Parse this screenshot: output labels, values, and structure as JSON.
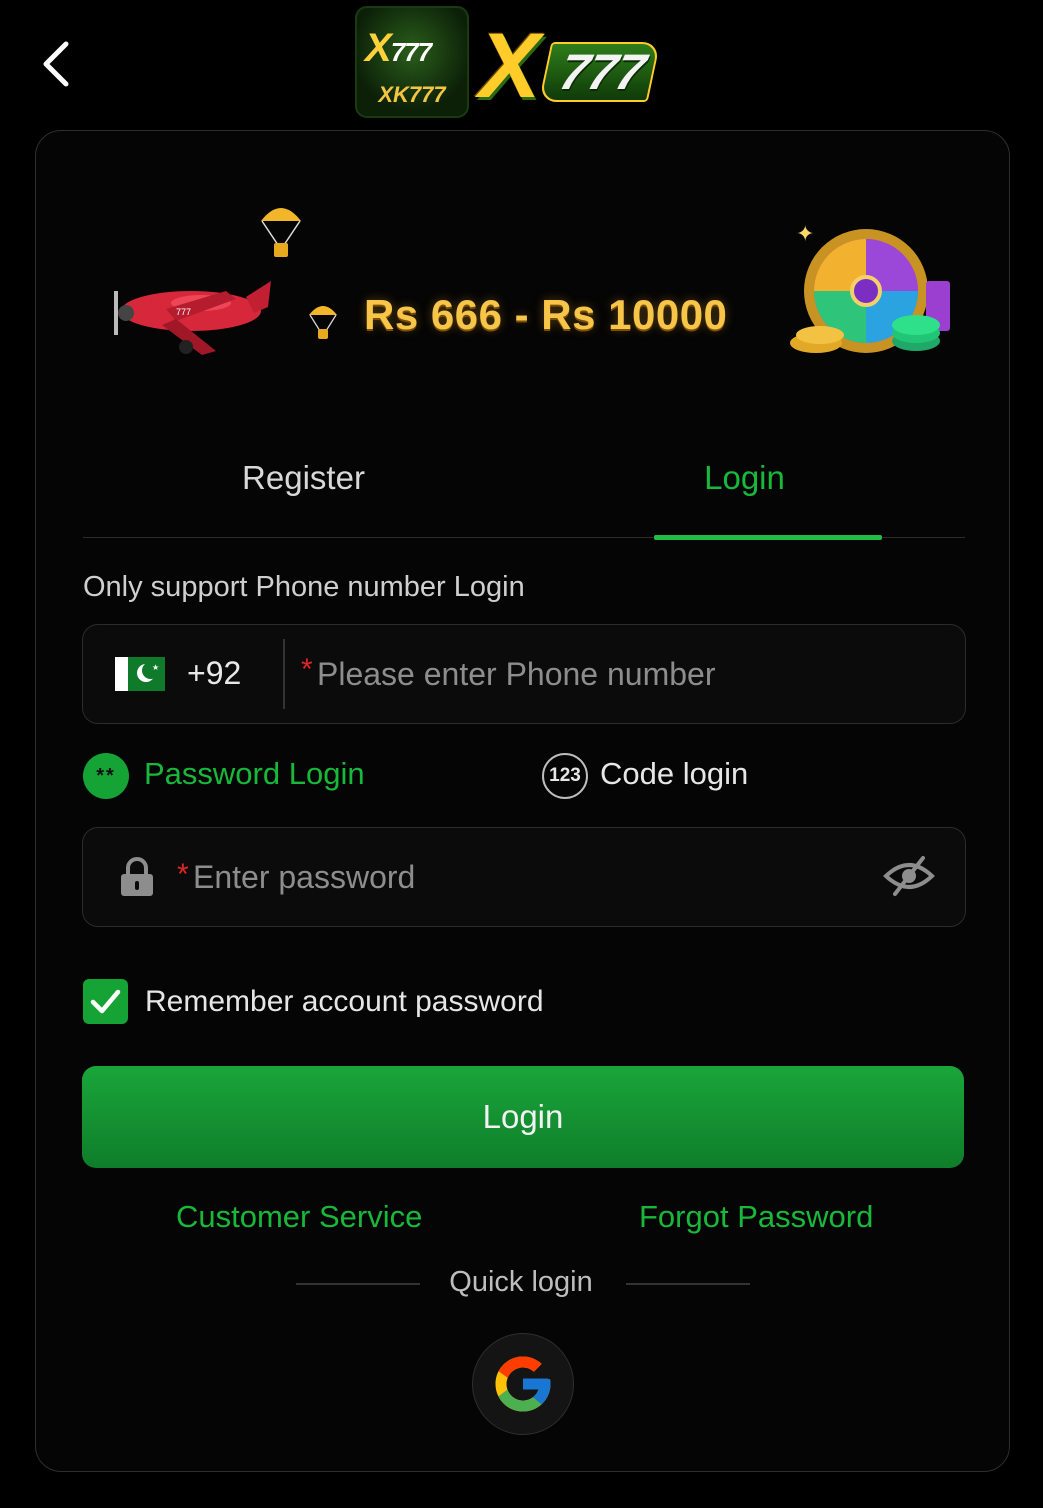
{
  "header": {
    "logo_text": "XK777",
    "brand_mark": "777"
  },
  "banner": {
    "prize_text": "Rs 666 - Rs 10000"
  },
  "tabs": [
    {
      "label": "Register",
      "active": false
    },
    {
      "label": "Login",
      "active": true
    }
  ],
  "form": {
    "hint": "Only support Phone number Login",
    "country_code": "+92",
    "phone_placeholder": "Please enter Phone number",
    "required_mark": "*",
    "modes": {
      "password_label": "Password Login",
      "password_icon_text": "**",
      "code_label": "Code login",
      "code_icon_text": "123"
    },
    "password_placeholder": "Enter password",
    "remember_label": "Remember account password",
    "remember_checked": true,
    "login_button": "Login"
  },
  "links": {
    "customer_service": "Customer Service",
    "forgot_password": "Forgot Password"
  },
  "quick_login": {
    "label": "Quick login"
  },
  "colors": {
    "accent": "#18b83a",
    "background": "#000000",
    "banner_gold": "#f7c548",
    "required": "#e02424"
  }
}
